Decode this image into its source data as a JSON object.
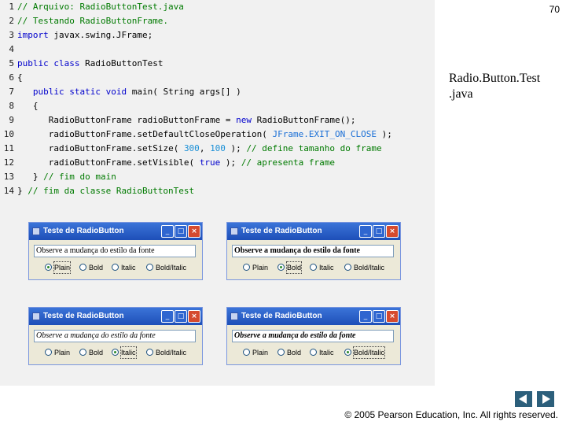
{
  "page_number": "70",
  "side_title": [
    "Radio.Button.Test",
    ".java"
  ],
  "copyright": "© 2005 Pearson Education, Inc.  All rights reserved.",
  "nav": {
    "prev_icon": "triangle-left",
    "next_icon": "triangle-right"
  },
  "code": {
    "line_numbers": [
      "1",
      "2",
      "3",
      "4",
      "5",
      "6",
      "7",
      "8",
      "9",
      "10",
      "11",
      "12",
      "13",
      "14"
    ],
    "l1": "// Arquivo: RadioButtonTest.java",
    "l2": "// Testando RadioButtonFrame.",
    "l3_kw": "import",
    "l3_rest": " javax.swing.JFrame;",
    "l5_kw": "public class",
    "l5_rest": " RadioButtonTest",
    "l6": "{",
    "l7_kw": "public static void",
    "l7_rest": " main( String args[] )",
    "l8": "{",
    "l9_a": "RadioButtonFrame radioButtonFrame = ",
    "l9_kw": "new",
    "l9_b": " RadioButtonFrame();",
    "l10_a": "radioButtonFrame.setDefaultCloseOperation( ",
    "l10_const": "JFrame.EXIT_ON_CLOSE",
    "l10_b": " );",
    "l11_a": "radioButtonFrame.setSize( ",
    "l11_n1": "300",
    "l11_sep": ", ",
    "l11_n2": "100",
    "l11_b": " ); ",
    "l11_comment": "// define tamanho do frame",
    "l12_a": "radioButtonFrame.setVisible( ",
    "l12_kw": "true",
    "l12_b": " ); ",
    "l12_comment": "// apresenta frame",
    "l13_a": "} ",
    "l13_comment": "// fim do main",
    "l14_a": "} ",
    "l14_comment": "// fim da classe RadioButtonTest"
  },
  "windows": [
    {
      "title": "Teste de RadioButton",
      "text": "Observe a mudança do estilo da fonte",
      "style": "plain",
      "radios": [
        "Plain",
        "Bold",
        "Italic",
        "Bold/Italic"
      ],
      "selected": "Plain"
    },
    {
      "title": "Teste de RadioButton",
      "text": "Observe a mudança do estilo da fonte",
      "style": "bold",
      "radios": [
        "Plain",
        "Bold",
        "Italic",
        "Bold/Italic"
      ],
      "selected": "Bold"
    },
    {
      "title": "Teste de RadioButton",
      "text": "Observe a mudança do estilo da fonte",
      "style": "italic",
      "radios": [
        "Plain",
        "Bold",
        "Italic",
        "Bold/Italic"
      ],
      "selected": "Italic"
    },
    {
      "title": "Teste de RadioButton",
      "text": "Observe a mudança do estilo da fonte",
      "style": "bold-italic",
      "radios": [
        "Plain",
        "Bold",
        "Italic",
        "Bold/Italic"
      ],
      "selected": "Bold/Italic"
    }
  ],
  "window_controls": {
    "minimize": "_",
    "maximize": "□",
    "close": "×"
  },
  "colors": {
    "comment": "#007a00",
    "keyword": "#0000cc",
    "number": "#1a8fd6",
    "titlebar": "#1e4fb8",
    "nav": "#2c5f7b"
  }
}
